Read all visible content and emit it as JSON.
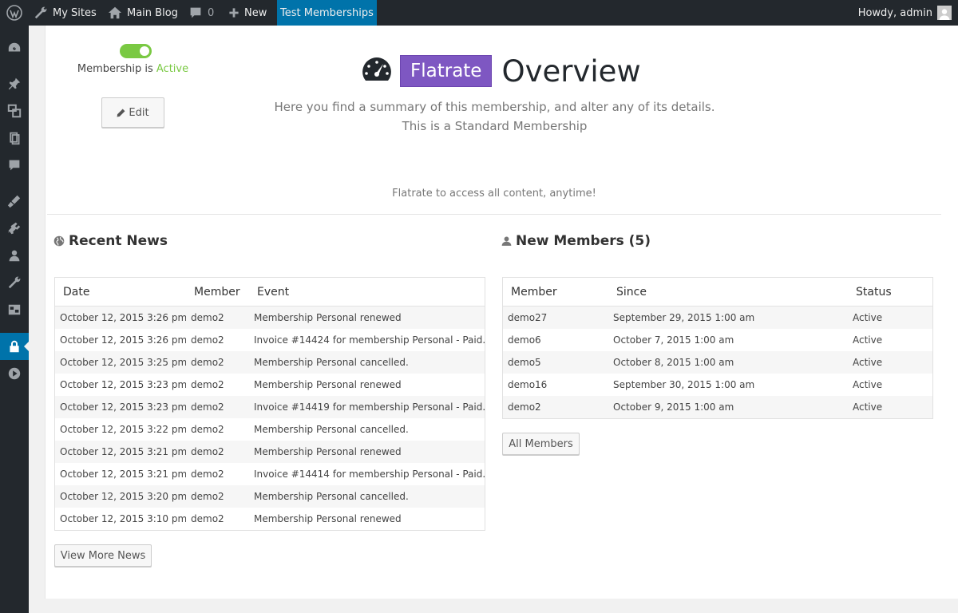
{
  "adminbar": {
    "my_sites": "My Sites",
    "main_blog": "Main Blog",
    "comments_count": "0",
    "new_label": "New",
    "site_name": "Test Memberships",
    "howdy": "Howdy, admin",
    "icons": [
      "wordpress-icon",
      "wrench-icon",
      "home-icon",
      "comment-icon",
      "plus-icon",
      "avatar"
    ]
  },
  "sidebar": {
    "items": [
      {
        "icon": "dashboard-icon"
      },
      {
        "icon": "pin-icon"
      },
      {
        "icon": "media-icon"
      },
      {
        "icon": "pages-icon"
      },
      {
        "icon": "comments-icon"
      },
      {
        "icon": "appearance-icon"
      },
      {
        "icon": "plugins-icon"
      },
      {
        "icon": "users-icon"
      },
      {
        "icon": "tools-icon"
      },
      {
        "icon": "settings-icon"
      },
      {
        "icon": "lock-icon",
        "current": true
      },
      {
        "icon": "play-icon"
      }
    ]
  },
  "status": {
    "prefix": "Membership is ",
    "state": "Active",
    "edit_label": "Edit"
  },
  "header": {
    "badge": "Flatrate",
    "title": "Overview",
    "subtitle_1": "Here you find a summary of this membership, and alter any of its details.",
    "subtitle_2": "This is a Standard Membership",
    "description": "Flatrate to access all content, anytime!"
  },
  "news": {
    "title": "Recent News",
    "columns": [
      "Date",
      "Member",
      "Event"
    ],
    "rows": [
      [
        "October 12, 2015 3:26 pm",
        "demo2",
        "Membership Personal renewed"
      ],
      [
        "October 12, 2015 3:26 pm",
        "demo2",
        "Invoice #14424 for membership Personal - Paid."
      ],
      [
        "October 12, 2015 3:25 pm",
        "demo2",
        "Membership Personal cancelled."
      ],
      [
        "October 12, 2015 3:23 pm",
        "demo2",
        "Membership Personal renewed"
      ],
      [
        "October 12, 2015 3:23 pm",
        "demo2",
        "Invoice #14419 for membership Personal - Paid."
      ],
      [
        "October 12, 2015 3:22 pm",
        "demo2",
        "Membership Personal cancelled."
      ],
      [
        "October 12, 2015 3:21 pm",
        "demo2",
        "Membership Personal renewed"
      ],
      [
        "October 12, 2015 3:21 pm",
        "demo2",
        "Invoice #14414 for membership Personal - Paid."
      ],
      [
        "October 12, 2015 3:20 pm",
        "demo2",
        "Membership Personal cancelled."
      ],
      [
        "October 12, 2015 3:10 pm",
        "demo2",
        "Membership Personal renewed"
      ]
    ],
    "button": "View More News"
  },
  "members": {
    "title": "New Members (5)",
    "columns": [
      "Member",
      "Since",
      "Status"
    ],
    "rows": [
      [
        "demo27",
        "September 29, 2015 1:00 am",
        "Active"
      ],
      [
        "demo6",
        "October 7, 2015 1:00 am",
        "Active"
      ],
      [
        "demo5",
        "October 8, 2015 1:00 am",
        "Active"
      ],
      [
        "demo16",
        "September 30, 2015 1:00 am",
        "Active"
      ],
      [
        "demo2",
        "October 9, 2015 1:00 am",
        "Active"
      ]
    ],
    "button": "All Members"
  },
  "colors": {
    "adminbar_bg": "#23282d",
    "accent_blue": "#0073aa",
    "active_green": "#7ac943",
    "badge_purple": "#7e57c2"
  }
}
